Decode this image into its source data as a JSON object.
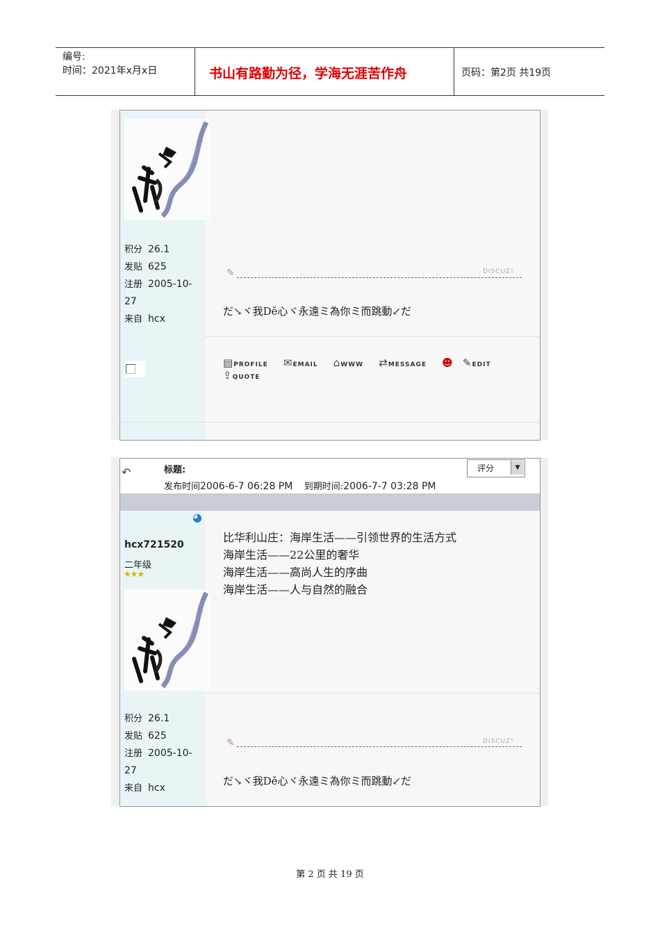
{
  "header": {
    "number_label": "编号:",
    "time_label": "时间：2021年x月x日",
    "motto": "书山有路勤为径，学海无涯苦作舟",
    "page_label": "页码：第2页 共19页"
  },
  "post1": {
    "stats": [
      {
        "key": "积分",
        "value": "26.1"
      },
      {
        "key": "发贴",
        "value": "625"
      },
      {
        "key": "注册",
        "value": "2005-10-"
      },
      {
        "key": "",
        "value": "27"
      },
      {
        "key": "来自",
        "value": "hcx"
      }
    ],
    "discuz": "DISCUZ!",
    "signature": "だ↘ヾ我Dě心ヾ永遠ミ為你ミ而跳動↙だ",
    "buttons": [
      {
        "icon": "profile-icon",
        "label": "PROFILE"
      },
      {
        "icon": "email-icon",
        "label": "EMAIL"
      },
      {
        "icon": "www-icon",
        "label": "WWW"
      },
      {
        "icon": "message-icon",
        "label": "MESSAGE"
      },
      {
        "icon": "qq-icon",
        "label": ""
      },
      {
        "icon": "edit-icon",
        "label": "EDIT"
      },
      {
        "icon": "quote-icon",
        "label": "QUOTE"
      }
    ]
  },
  "post2": {
    "title_label": "标题:",
    "published_label": "发布时间",
    "published": "2006-6-7 06:28 PM",
    "expire_label": "到期时间:",
    "expire": "2006-7-7 03:28 PM",
    "rate_label": "评分",
    "username": "hcx721520",
    "rank": "二年级",
    "stars": "★★★",
    "content": [
      "比华利山庄：海岸生活——引领世界的生活方式",
      "海岸生活——22公里的奢华",
      "海岸生活——高尚人生的序曲",
      "海岸生活——人与自然的融合"
    ],
    "stats": [
      {
        "key": "积分",
        "value": "26.1"
      },
      {
        "key": "发贴",
        "value": "625"
      },
      {
        "key": "注册",
        "value": "2005-10-"
      },
      {
        "key": "",
        "value": "27"
      },
      {
        "key": "来自",
        "value": "hcx"
      }
    ],
    "discuz": "DISCUZ!",
    "signature": "だ↘ヾ我Dě心ヾ永遠ミ為你ミ而跳動↙だ"
  },
  "footer": "第 2 页 共 19 页"
}
